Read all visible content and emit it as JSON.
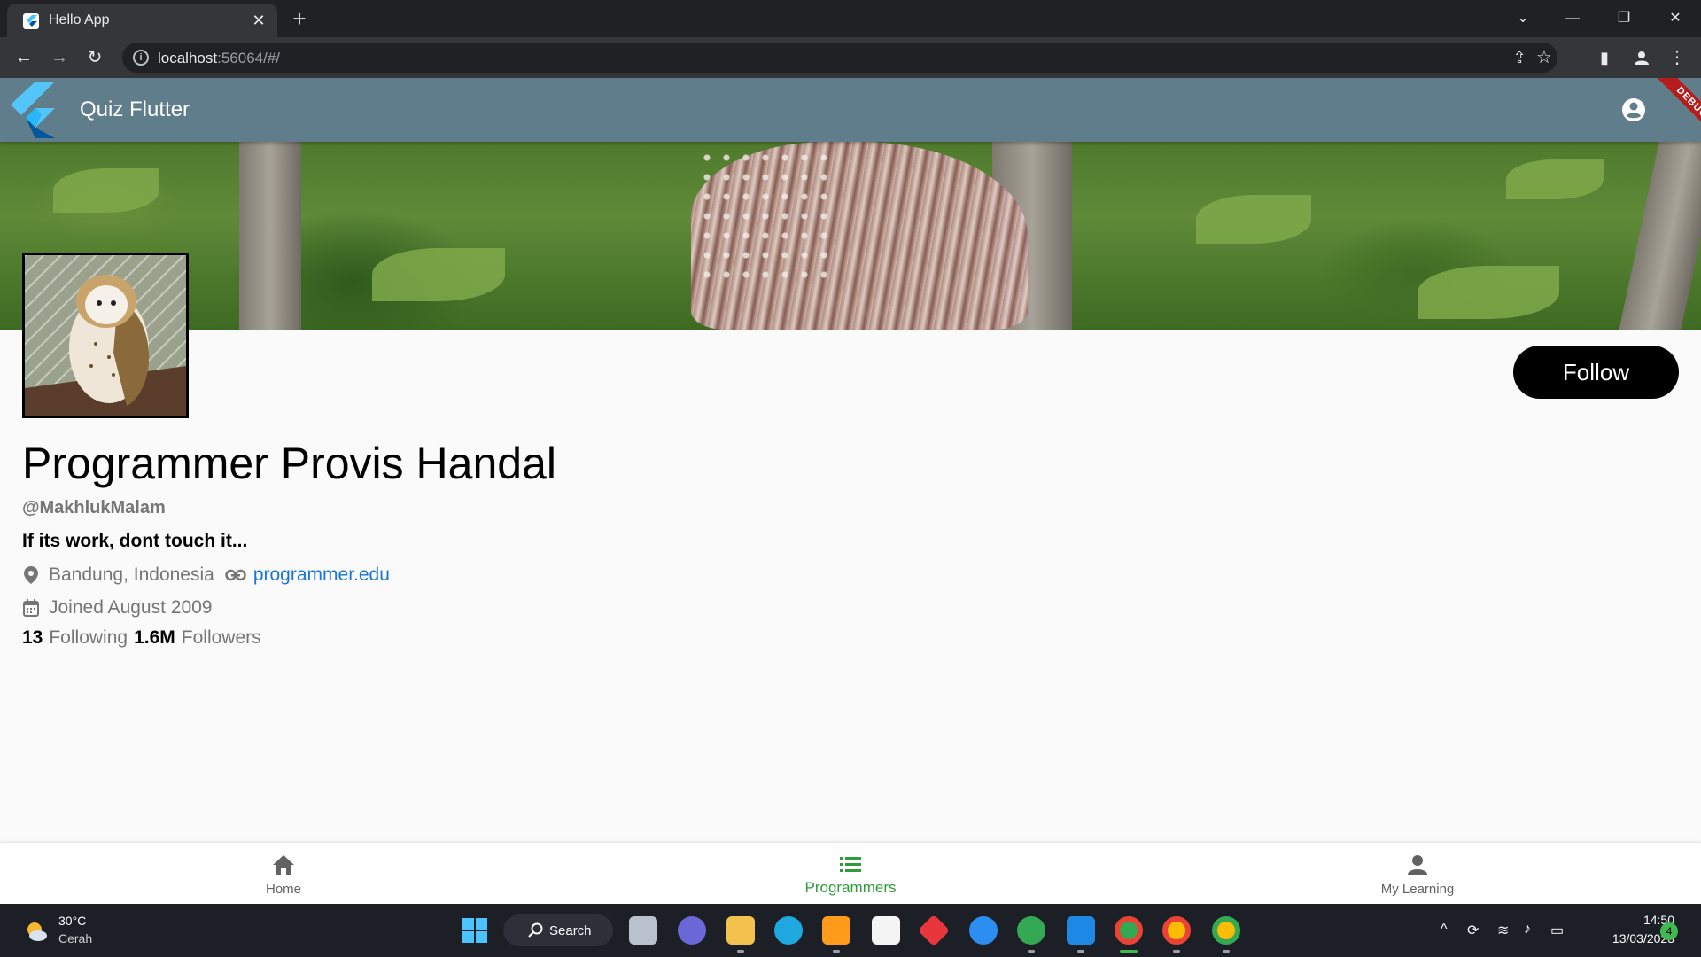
{
  "browser": {
    "tab_title": "Hello App",
    "url_host": "localhost",
    "url_rest": ":56064/#/"
  },
  "app": {
    "title": "Quiz Flutter",
    "debug_label": "DEBUG",
    "appbar_color": "#607d8b"
  },
  "profile": {
    "name": "Programmer Provis Handal",
    "handle": "@MakhlukMalam",
    "bio": "If its work, dont touch it...",
    "location": "Bandung, Indonesia",
    "website": "programmer.edu",
    "joined": "Joined August 2009",
    "following_count": "13",
    "following_label": "Following",
    "followers_count": "1.6M",
    "followers_label": "Followers",
    "follow_button": "Follow"
  },
  "bottom_nav": {
    "items": [
      {
        "label": "Home",
        "icon": "home-icon"
      },
      {
        "label": "Programmers",
        "icon": "list-icon",
        "active": true
      },
      {
        "label": "My Learning",
        "icon": "person-icon"
      }
    ],
    "active_color": "#2e9c3a"
  },
  "taskbar": {
    "weather_temp": "30°C",
    "weather_desc": "Cerah",
    "search_label": "Search",
    "time": "14:50",
    "date": "13/03/2023",
    "notification_count": "4"
  }
}
